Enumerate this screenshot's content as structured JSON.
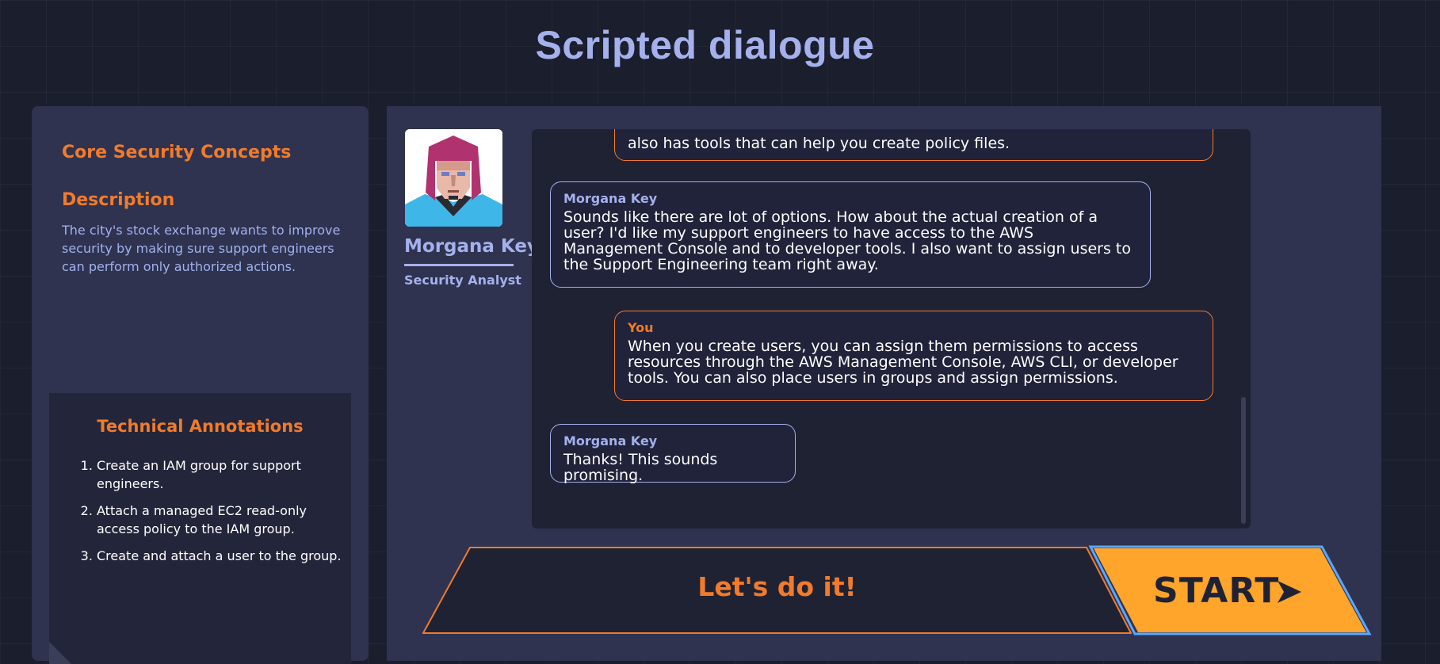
{
  "page": {
    "title": "Scripted dialogue"
  },
  "sidebar": {
    "topic": "Core Security Concepts",
    "description_heading": "Description",
    "description": "The city's stock exchange wants to improve security by making sure support engineers can perform only authorized actions.",
    "annotations_title": "Technical Annotations",
    "annotations": [
      "Create an IAM group for support engineers.",
      "Attach a managed EC2 read-only access policy to the IAM group.",
      "Create and attach a user to the group."
    ]
  },
  "character": {
    "name": "Morgana Key",
    "role": "Security Analyst",
    "avatar_icon": "person-avatar-icon"
  },
  "dialogue": {
    "messages": [
      {
        "speaker": "",
        "role": "you",
        "text": "also has tools that can help you create policy files."
      },
      {
        "speaker": "Morgana Key",
        "role": "npc",
        "text": "Sounds like there are lot of options. How about the actual creation of a user? I'd like my support engineers to have access to the AWS Management Console and to developer tools. I also want to assign users to the Support Engineering team right away."
      },
      {
        "speaker": "You",
        "role": "you",
        "text": "When you create users, you can assign them permissions to access resources through the AWS Management Console, AWS CLI, or developer tools. You can also place users in groups and assign permissions."
      },
      {
        "speaker": "Morgana Key",
        "role": "npc",
        "text": "Thanks! This sounds promising."
      }
    ]
  },
  "actions": {
    "response_label": "Let's do it!",
    "start_label": "START",
    "start_icon": "send-arrow-icon"
  },
  "colors": {
    "accent_orange": "#f27b2a",
    "accent_blue": "#a4b1ec",
    "start_yellow": "#ffa52b"
  }
}
